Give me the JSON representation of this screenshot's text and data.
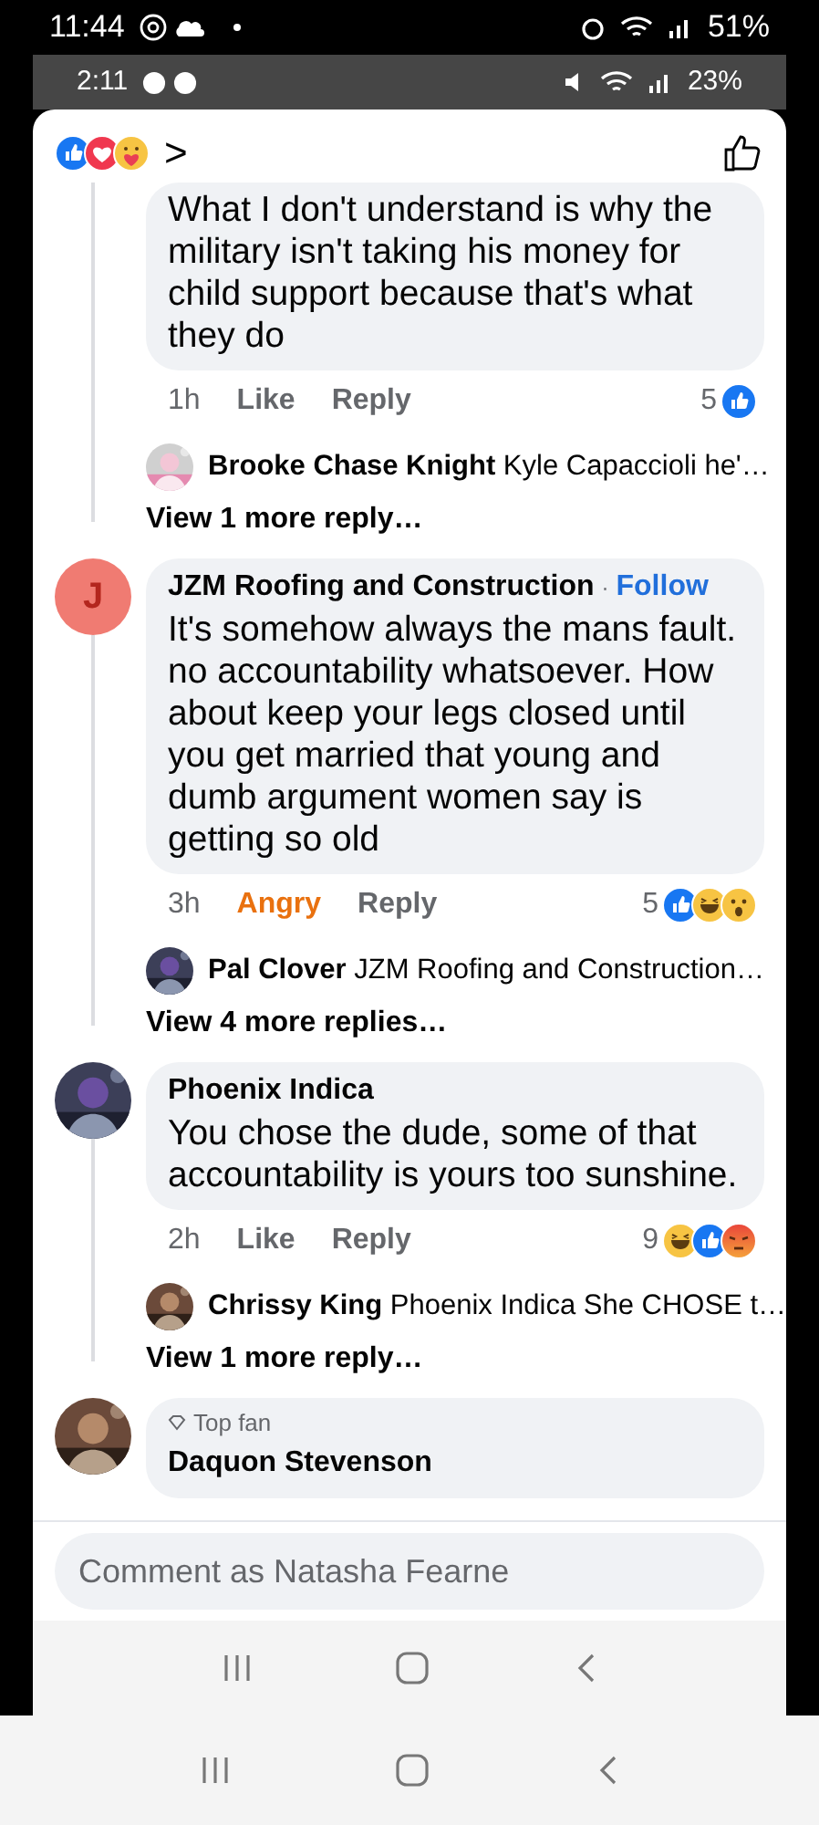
{
  "outer_status": {
    "time": "11:44",
    "battery": "51%"
  },
  "inner_status": {
    "time": "2:11",
    "battery": "23%"
  },
  "header": {
    "reactions": [
      {
        "kind": "like"
      },
      {
        "kind": "love"
      },
      {
        "kind": "care"
      }
    ],
    "chevron": ">"
  },
  "comments": [
    {
      "text": "What I don't understand is why the military isn't taking his money for child support because that's what they do",
      "time": "1h",
      "reaction_label": "Like",
      "reacted": false,
      "reply_label": "Reply",
      "count": "5",
      "reactions": [
        {
          "kind": "like"
        }
      ],
      "reply": {
        "name": "Brooke Chase Knight",
        "text": "Kyle Capaccioli he'…"
      },
      "more": "View 1 more reply…"
    },
    {
      "avatar": {
        "kind": "letter",
        "letter": "J",
        "color": "#f07b72"
      },
      "author": "JZM Roofing and Construction",
      "separator": "·",
      "follow": "Follow",
      "text": "It's somehow always the mans fault. no accountability whatsoever. How about keep your legs closed until you get married that young and dumb argument women say is getting so old",
      "time": "3h",
      "reaction_label": "Angry",
      "reacted": true,
      "reply_label": "Reply",
      "count": "5",
      "reactions": [
        {
          "kind": "like"
        },
        {
          "kind": "haha"
        },
        {
          "kind": "wow"
        }
      ],
      "reply": {
        "name": "Pal Clover",
        "text": "JZM Roofing and Construction…"
      },
      "more": "View 4 more replies…"
    },
    {
      "avatar": {
        "kind": "picture"
      },
      "author": "Phoenix Indica",
      "text": "You chose the dude, some of that accountability is yours too sunshine.",
      "time": "2h",
      "reaction_label": "Like",
      "reacted": false,
      "reply_label": "Reply",
      "count": "9",
      "reactions": [
        {
          "kind": "haha"
        },
        {
          "kind": "like"
        },
        {
          "kind": "angry"
        }
      ],
      "reply": {
        "name": "Chrissy King",
        "text": "Phoenix Indica She CHOSE t…"
      },
      "more": "View 1 more reply…"
    },
    {
      "avatar": {
        "kind": "picture"
      },
      "badge": "Top fan",
      "author": "Daquon Stevenson"
    }
  ],
  "composer": {
    "placeholder": "Comment as Natasha Fearne"
  }
}
